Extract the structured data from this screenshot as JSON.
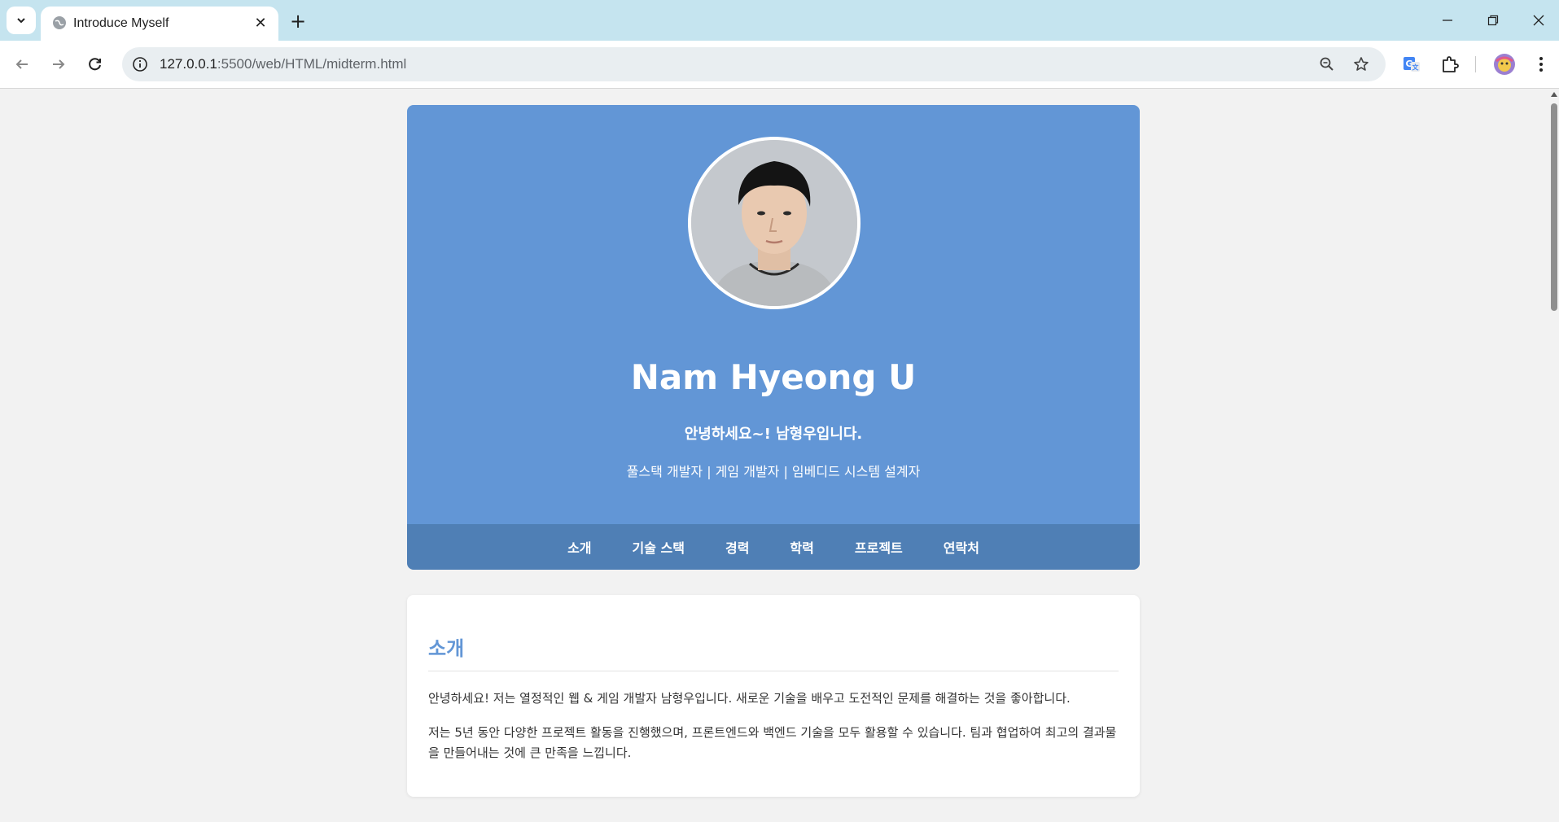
{
  "browser": {
    "tab_title": "Introduce Myself",
    "tab_close": "✕",
    "new_tab": "+",
    "url_host": "127.0.0.1",
    "url_rest": ":5500/web/HTML/midterm.html"
  },
  "profile": {
    "name": "Nam Hyeong U",
    "greeting": "안녕하세요~! 남형우입니다.",
    "roles": "풀스택 개발자 | 게임 개발자 | 임베디드 시스템 설계자"
  },
  "nav": {
    "items": [
      "소개",
      "기술 스택",
      "경력",
      "학력",
      "프로젝트",
      "연락처"
    ]
  },
  "intro": {
    "title": "소개",
    "p1": "안녕하세요! 저는 열정적인 웹 & 게임 개발자 남형우입니다. 새로운 기술을 배우고 도전적인 문제를 해결하는 것을 좋아합니다.",
    "p2": "저는 5년 동안 다양한 프로젝트 활동을 진행했으며, 프론트엔드와 백엔드 기술을 모두 활용할 수 있습니다. 팀과 협업하여 최고의 결과물을 만들어내는 것에 큰 만족을 느낍니다."
  },
  "colors": {
    "header_bg": "#6296d6",
    "nav_bg": "#4f7fb5",
    "accent": "#6296d6",
    "tabbar_bg": "#c5e4ef"
  }
}
